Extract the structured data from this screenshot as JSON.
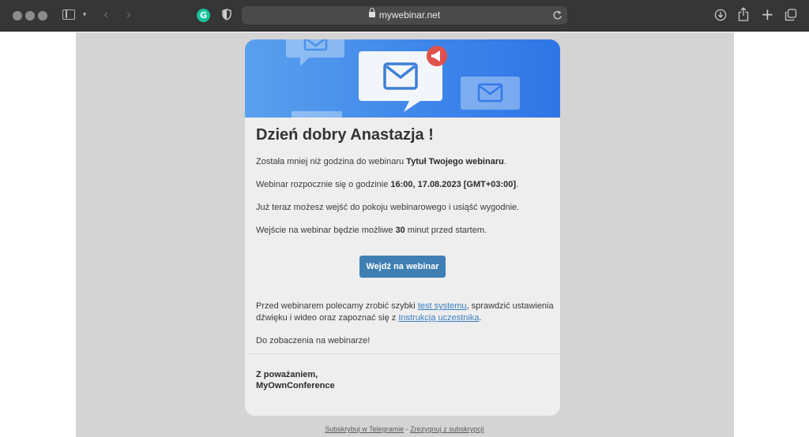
{
  "browser": {
    "url": "mywebinar.net",
    "icons": [
      "traffic-light-icon",
      "sidebar-icon",
      "chevron-down-icon",
      "back-icon",
      "forward-icon",
      "grammarly-icon",
      "shield-icon",
      "lock-icon",
      "reload-icon",
      "download-icon",
      "share-icon",
      "new-tab-icon",
      "tabs-overview-icon"
    ],
    "grammarly_glyph": "G"
  },
  "email": {
    "greeting": "Dzień dobry Anastazja !",
    "p1_prefix": "Została mniej niż godzina do webinaru ",
    "p1_bold": "Tytuł Twojego webinaru",
    "p1_suffix": ".",
    "p2_prefix": "Webinar rozpocznie się o godzinie ",
    "p2_bold": "16:00, 17.08.2023 [GMT+03:00]",
    "p2_suffix": ".",
    "p3": "Już teraz możesz wejść do pokoju webinarowego i usiąść wygodnie.",
    "p4_prefix": "Wejście na webinar będzie możliwe ",
    "p4_bold": "30",
    "p4_suffix": " minut przed startem.",
    "button_label": "Wejdź na webinar",
    "p5_prefix": "Przed webinarem polecamy zrobić szybki ",
    "p5_link1": "test systemu",
    "p5_middle": ", sprawdzić ustawienia dźwięku i wideo oraz zapoznać się z ",
    "p5_link2": "Instrukcją uczestnika",
    "p5_suffix": ".",
    "p6": "Do zobaczenia na webinarze!",
    "sign_line1": "Z poważaniem,",
    "sign_line2": "MyOwnConference"
  },
  "footer": {
    "link1": "Subskrybuj w Telegramie",
    "separator": " - ",
    "link2": "Zrezygnuj z subskrypcji"
  },
  "colors": {
    "banner_start": "#5aa0ee",
    "banner_end": "#2f76e6",
    "button": "#3f7fb4",
    "link": "#3a7fc2",
    "notification": "#e0514b"
  }
}
